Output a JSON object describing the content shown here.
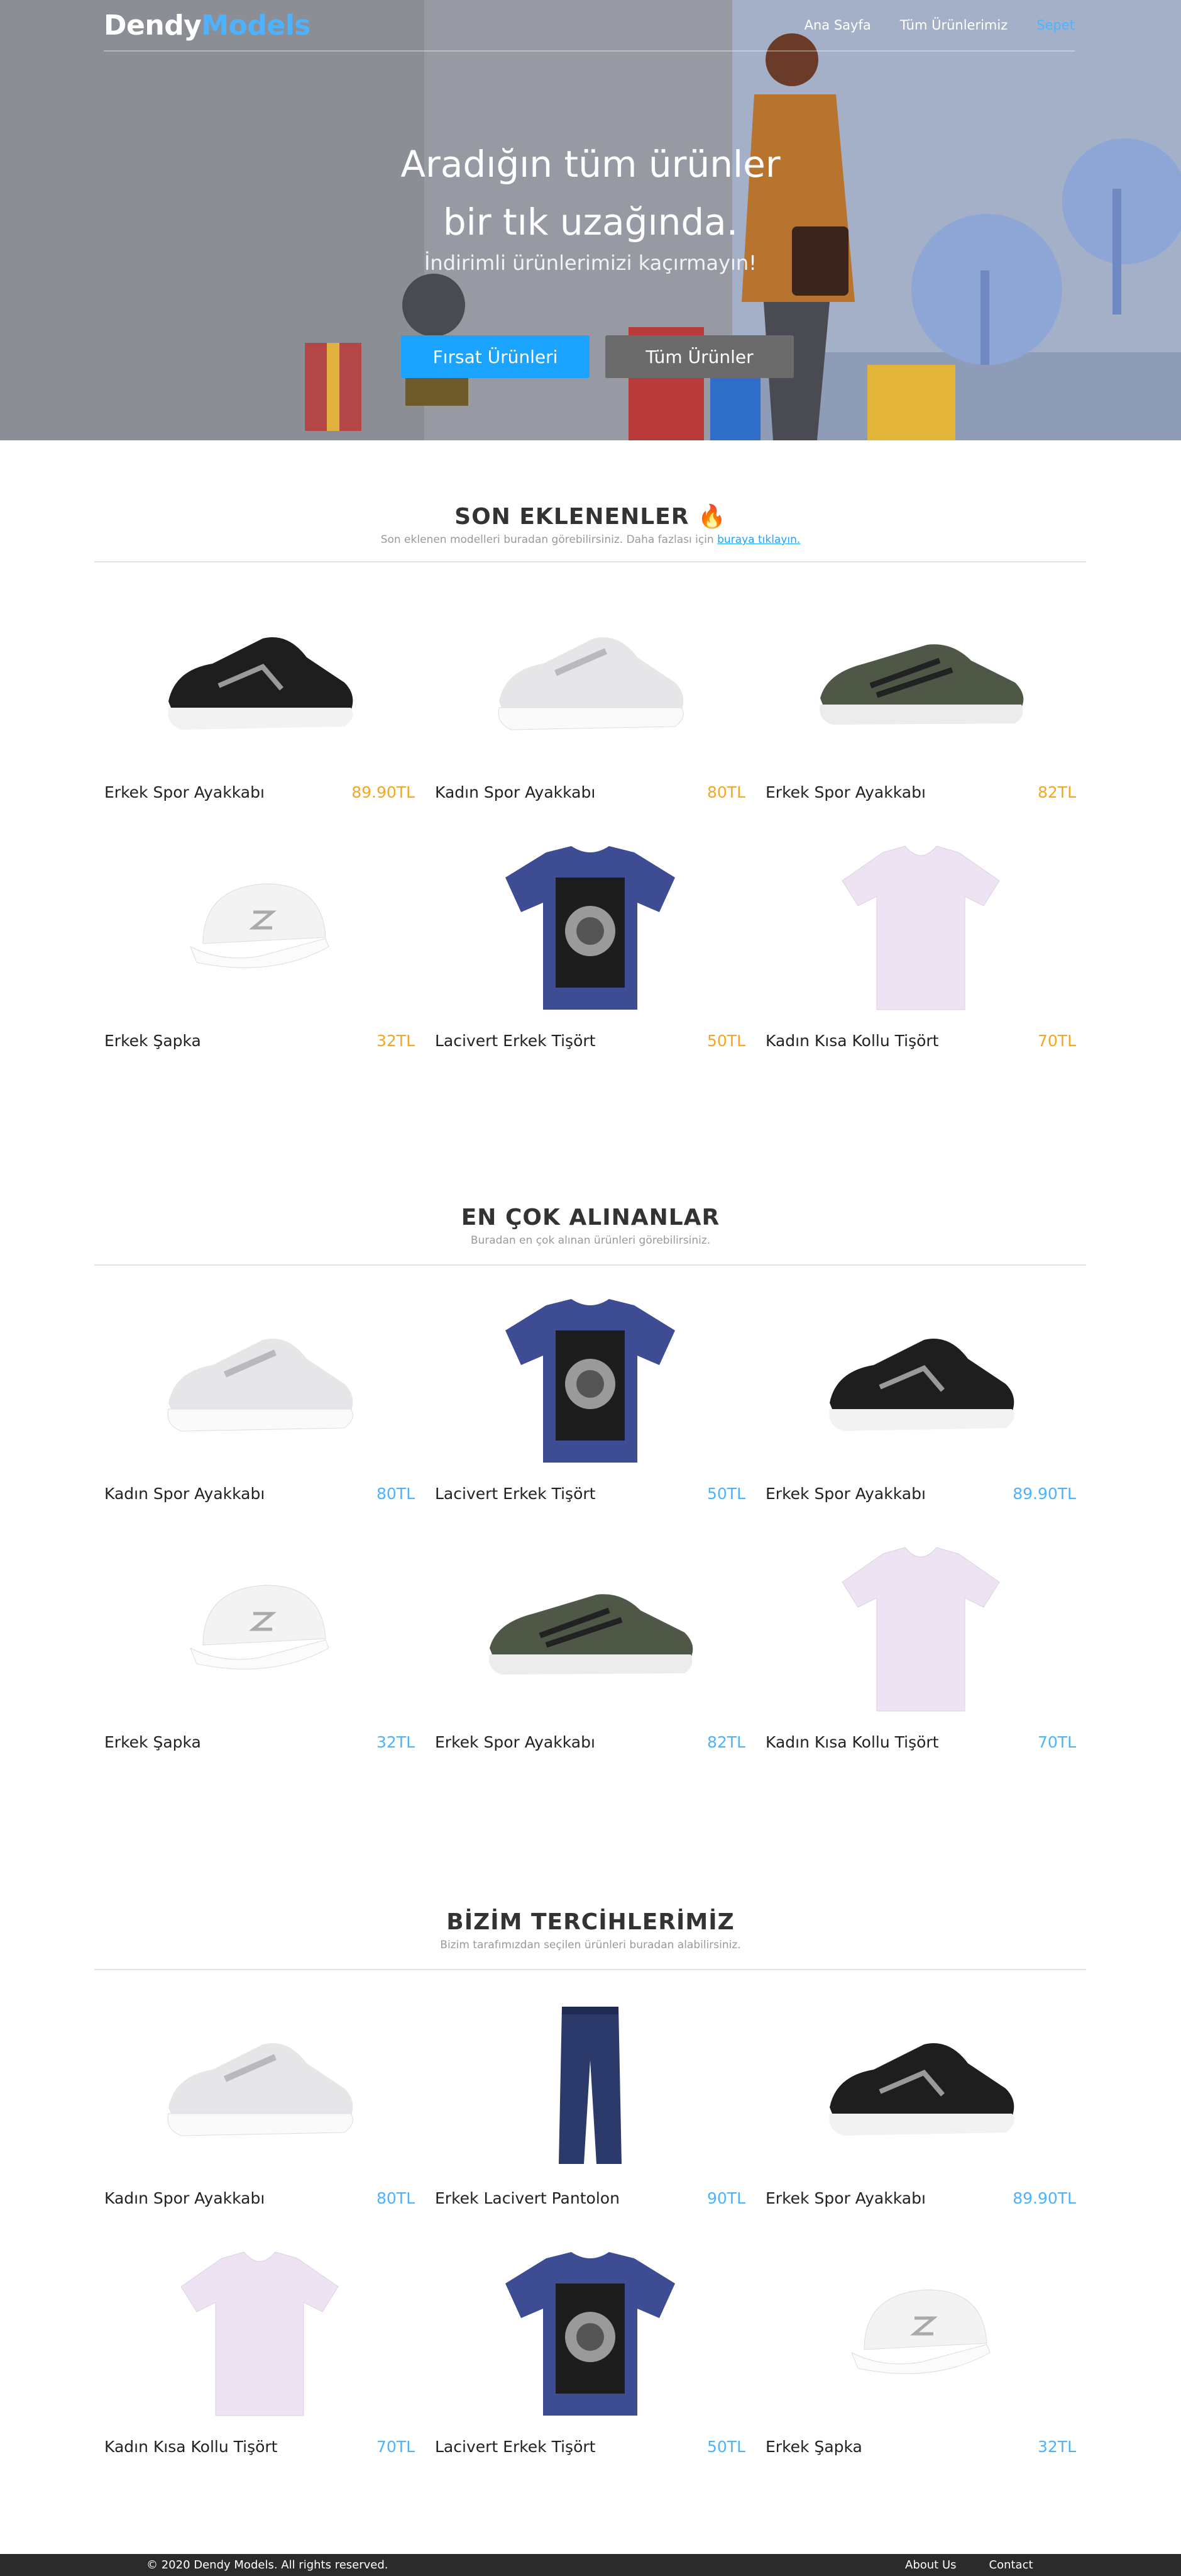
{
  "nav": {
    "logo_part1": "Dendy",
    "logo_part2": "Models",
    "links": [
      "Ana Sayfa",
      "Tüm Ürünlerimiz",
      "Sepet"
    ]
  },
  "hero": {
    "title_line1": "Aradığın tüm ürünler",
    "title_line2": "bir tık uzağında.",
    "subtitle": "İndirimli ürünlerimizi kaçırmayın!",
    "primary_button": "Fırsat Ürünleri",
    "secondary_button": "Tüm Ürünler"
  },
  "sections": [
    {
      "title": "SON EKLENENLER",
      "emoji": "🔥",
      "subtitle": "Son eklenen modelleri buradan görebilirsiniz. Daha fazlası için",
      "link": "buraya tıklayın.",
      "products": [
        {
          "name": "Erkek Spor Ayakkabı",
          "price": "89.90TL",
          "image": "black-sneaker"
        },
        {
          "name": "Kadın Spor Ayakkabı",
          "price": "80TL",
          "image": "white-sneaker"
        },
        {
          "name": "Erkek Spor Ayakkabı",
          "price": "82TL",
          "image": "green-sneaker"
        },
        {
          "name": "Erkek Şapka",
          "price": "32TL",
          "image": "white-cap"
        },
        {
          "name": "Lacivert Erkek Tişört",
          "price": "50TL",
          "image": "navy-tshirt"
        },
        {
          "name": "Kadın Kısa Kollu Tişört",
          "price": "70TL",
          "image": "lilac-tshirt"
        }
      ]
    },
    {
      "title": "EN ÇOK ALINANLAR",
      "subtitle": "Buradan en çok alınan ürünleri görebilirsiniz.",
      "products": [
        {
          "name": "Kadın Spor Ayakkabı",
          "price": "80TL",
          "image": "white-sneaker"
        },
        {
          "name": "Lacivert Erkek Tişört",
          "price": "50TL",
          "image": "navy-tshirt"
        },
        {
          "name": "Erkek Spor Ayakkabı",
          "price": "89.90TL",
          "image": "black-sneaker"
        },
        {
          "name": "Erkek Şapka",
          "price": "32TL",
          "image": "white-cap"
        },
        {
          "name": "Erkek Spor Ayakkabı",
          "price": "82TL",
          "image": "green-sneaker"
        },
        {
          "name": "Kadın Kısa Kollu Tişört",
          "price": "70TL",
          "image": "lilac-tshirt"
        }
      ]
    },
    {
      "title": "BİZİM TERCİHLERİMİZ",
      "subtitle": "Bizim tarafımızdan seçilen ürünleri buradan alabilirsiniz.",
      "products": [
        {
          "name": "Kadın Spor Ayakkabı",
          "price": "80TL",
          "image": "white-sneaker"
        },
        {
          "name": "Erkek Lacivert Pantolon",
          "price": "90TL",
          "image": "navy-pants"
        },
        {
          "name": "Erkek Spor Ayakkabı",
          "price": "89.90TL",
          "image": "black-sneaker"
        },
        {
          "name": "Kadın Kısa Kollu Tişört",
          "price": "70TL",
          "image": "lilac-tshirt"
        },
        {
          "name": "Lacivert Erkek Tişört",
          "price": "50TL",
          "image": "navy-tshirt"
        },
        {
          "name": "Erkek Şapka",
          "price": "32TL",
          "image": "white-cap"
        }
      ]
    }
  ],
  "colors": {
    "accent": "#1aa3ff",
    "price_orange": "#f5a623",
    "price_blue": "#4fb2ff"
  },
  "footer": {
    "copyright": "© 2020 Dendy Models. All rights reserved.",
    "links": [
      "About Us",
      "Contact"
    ]
  }
}
